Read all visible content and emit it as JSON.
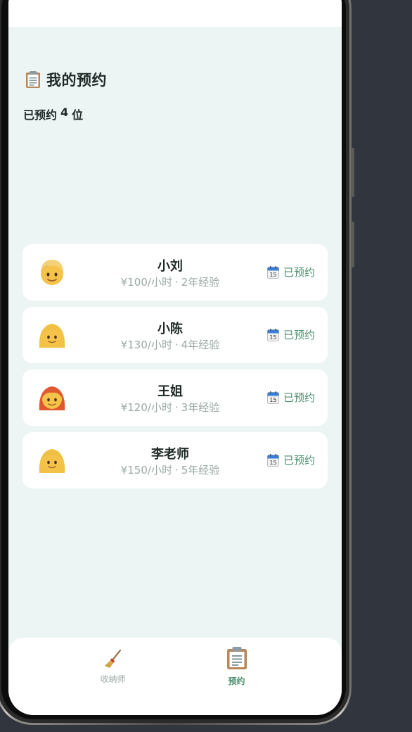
{
  "page": {
    "title": "我的预约",
    "title_icon": "clipboard-icon",
    "booked_prefix": "已预约",
    "booked_count": "4",
    "booked_suffix": "位"
  },
  "bookings": [
    {
      "name": "小刘",
      "price": "¥100/小时",
      "separator": "·",
      "experience": "2年经验",
      "avatar": "blond-person-emoji",
      "status": "已预约",
      "status_icon": "calendar-icon"
    },
    {
      "name": "小陈",
      "price": "¥130/小时",
      "separator": "·",
      "experience": "4年经验",
      "avatar": "blond-woman-emoji",
      "status": "已预约",
      "status_icon": "calendar-icon"
    },
    {
      "name": "王姐",
      "price": "¥120/小时",
      "separator": "·",
      "experience": "3年经验",
      "avatar": "red-haired-woman-emoji",
      "status": "已预约",
      "status_icon": "calendar-icon"
    },
    {
      "name": "李老师",
      "price": "¥150/小时",
      "separator": "·",
      "experience": "5年经验",
      "avatar": "blond-woman-emoji",
      "status": "已预约",
      "status_icon": "calendar-icon"
    }
  ],
  "tabs": [
    {
      "label": "收纳师",
      "icon": "broom-icon",
      "active": false
    },
    {
      "label": "预约",
      "icon": "clipboard-icon",
      "active": true
    }
  ],
  "colors": {
    "background": "#edf5f4",
    "card": "#ffffff",
    "accent_green": "#4d8f6e",
    "muted_text": "#9aa9a6",
    "dark_text": "#1f2a27"
  }
}
